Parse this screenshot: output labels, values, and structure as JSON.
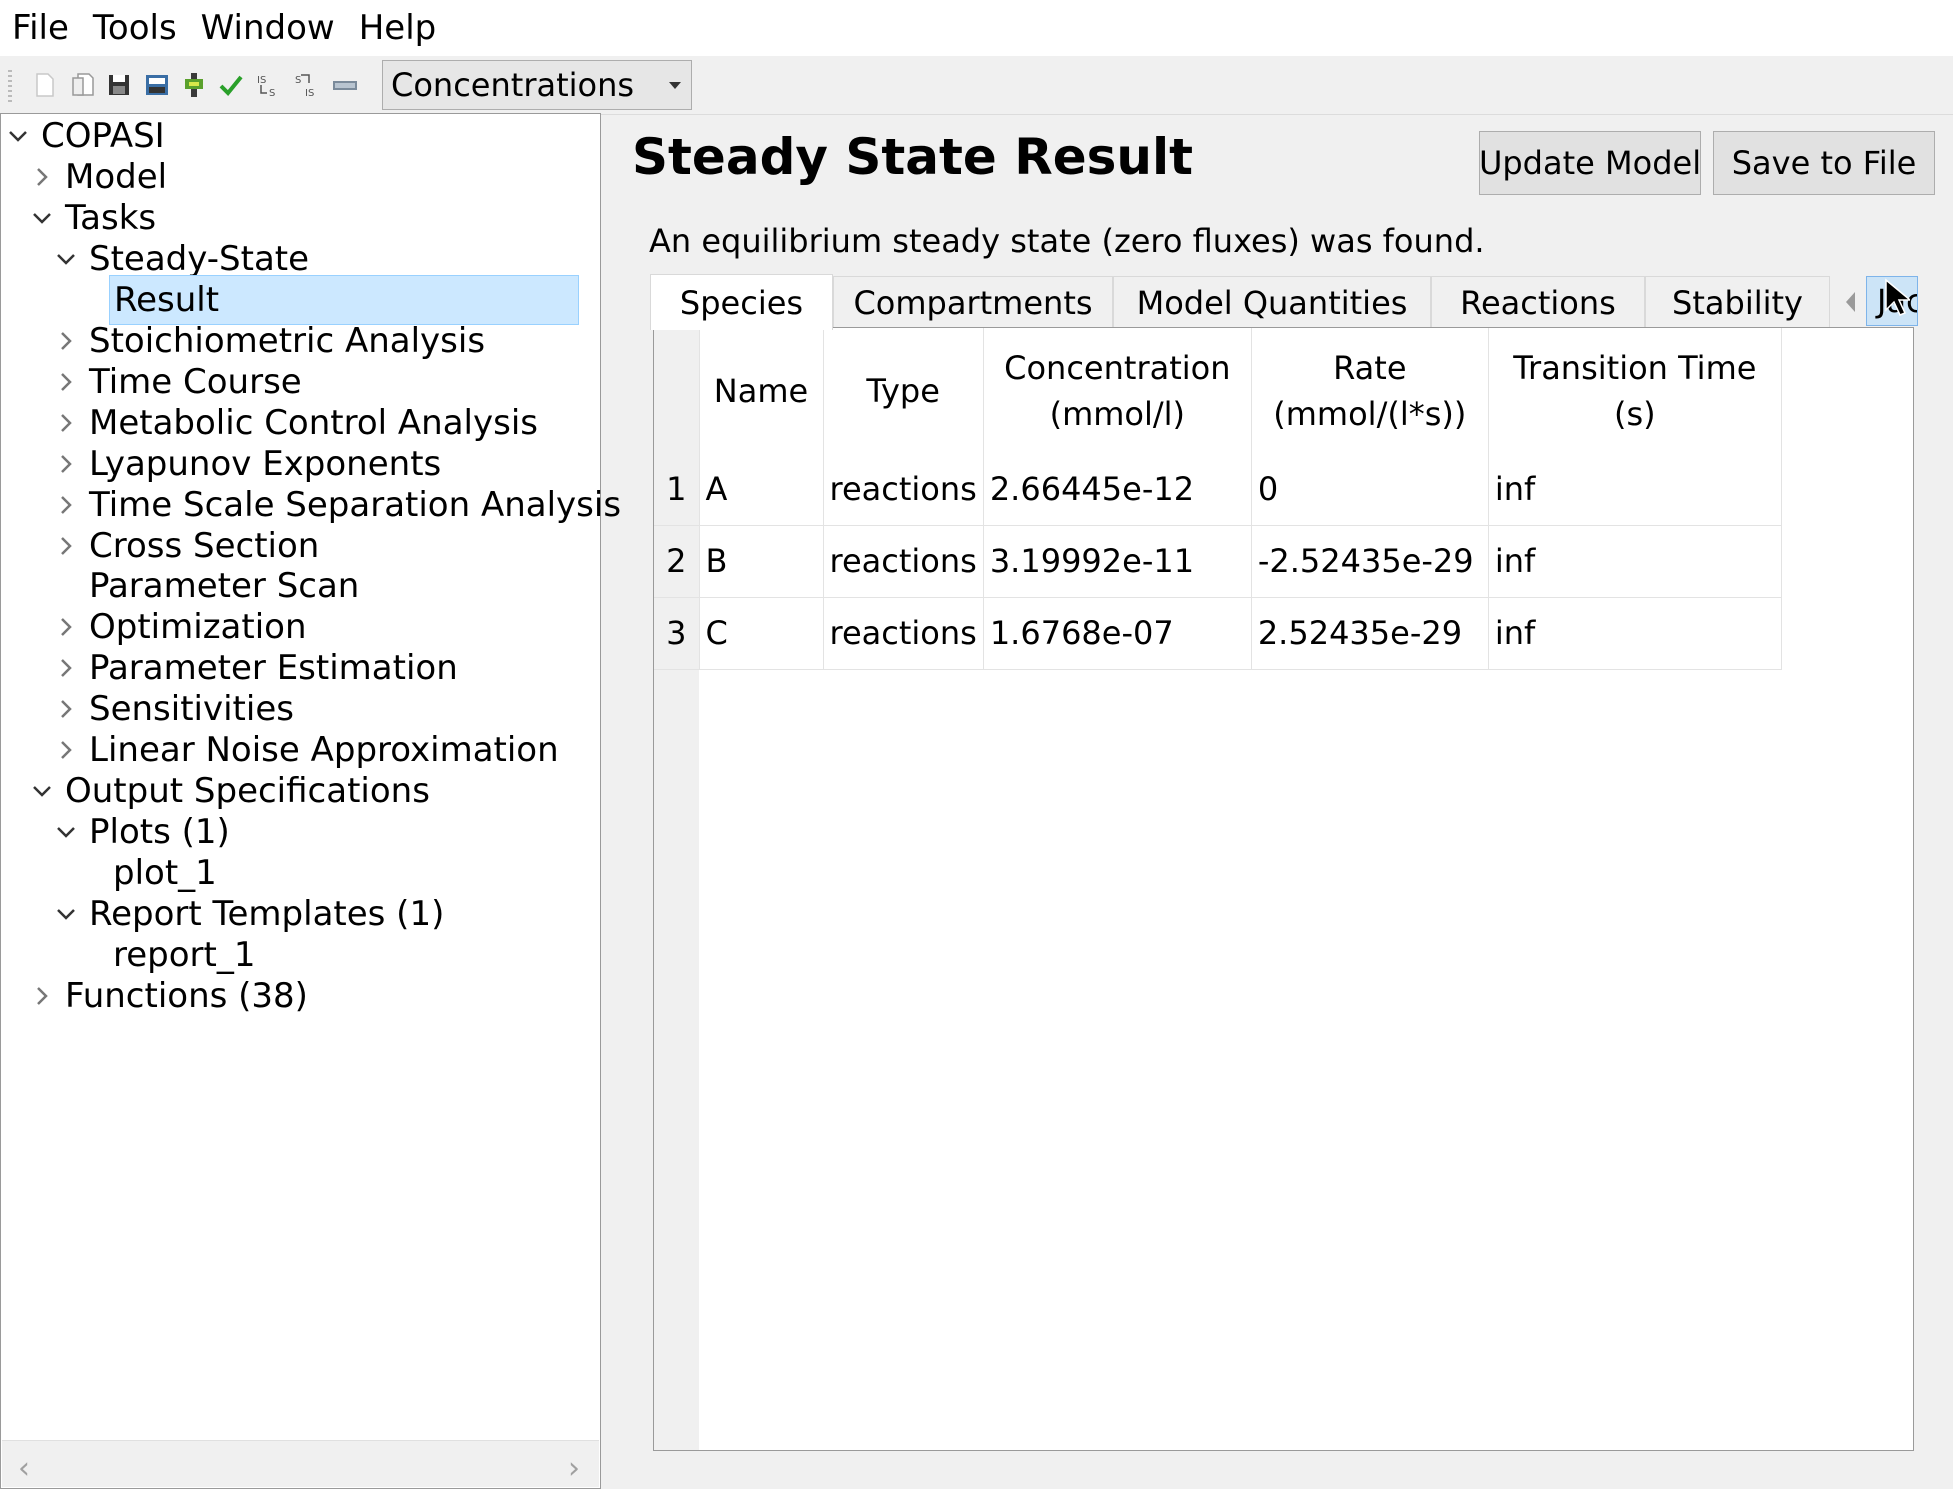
{
  "menu": [
    "File",
    "Tools",
    "Window",
    "Help"
  ],
  "toolbar": {
    "icons": [
      "new-file-icon",
      "open-file-icon",
      "save-icon",
      "save-as-icon",
      "check-model-icon",
      "apply-icon",
      "convert-to-irreversible-icon",
      "convert-to-reversible-icon",
      "slider-icon"
    ],
    "unit_select": "Concentrations"
  },
  "tree": {
    "items": [
      {
        "label": "COPASI",
        "expander": "open"
      },
      {
        "label": "Model",
        "expander": "closed"
      },
      {
        "label": "Tasks",
        "expander": "open"
      },
      {
        "label": "Steady-State",
        "expander": "open"
      },
      {
        "label": "Result",
        "expander": "none",
        "selected": true
      },
      {
        "label": "Stoichiometric Analysis",
        "expander": "closed"
      },
      {
        "label": "Time Course",
        "expander": "closed"
      },
      {
        "label": "Metabolic Control Analysis",
        "expander": "closed"
      },
      {
        "label": "Lyapunov Exponents",
        "expander": "closed"
      },
      {
        "label": "Time Scale Separation Analysis",
        "expander": "closed"
      },
      {
        "label": "Cross Section",
        "expander": "closed"
      },
      {
        "label": "Parameter Scan",
        "expander": "none"
      },
      {
        "label": "Optimization",
        "expander": "closed"
      },
      {
        "label": "Parameter Estimation",
        "expander": "closed"
      },
      {
        "label": "Sensitivities",
        "expander": "closed"
      },
      {
        "label": "Linear Noise Approximation",
        "expander": "closed"
      },
      {
        "label": "Output Specifications",
        "expander": "open"
      },
      {
        "label": "Plots (1)",
        "expander": "open"
      },
      {
        "label": "plot_1",
        "expander": "none"
      },
      {
        "label": "Report Templates (1)",
        "expander": "open"
      },
      {
        "label": "report_1",
        "expander": "none"
      },
      {
        "label": "Functions (38)",
        "expander": "closed"
      }
    ]
  },
  "main": {
    "title": "Steady State Result",
    "update_button": "Update Model",
    "save_button": "Save to File",
    "status": "An equilibrium steady state (zero fluxes) was found.",
    "tabs": [
      "Species",
      "Compartments",
      "Model Quantities",
      "Reactions",
      "Stability"
    ],
    "active_tab": "Species",
    "clipped_tab": "Jaco",
    "table": {
      "columns": [
        {
          "line1": "Name",
          "line2": ""
        },
        {
          "line1": "Type",
          "line2": ""
        },
        {
          "line1": "Concentration",
          "line2": "(mmol/l)"
        },
        {
          "line1": "Rate",
          "line2": "(mmol/(l*s))"
        },
        {
          "line1": "Transition Time",
          "line2": "(s)"
        }
      ],
      "rows": [
        {
          "num": "1",
          "cells": [
            "A",
            "reactions",
            "2.66445e-12",
            "0",
            "inf"
          ]
        },
        {
          "num": "2",
          "cells": [
            "B",
            "reactions",
            "3.19992e-11",
            "-2.52435e-29",
            "inf"
          ]
        },
        {
          "num": "3",
          "cells": [
            "C",
            "reactions",
            "1.6768e-07",
            "2.52435e-29",
            "inf"
          ]
        }
      ]
    }
  }
}
